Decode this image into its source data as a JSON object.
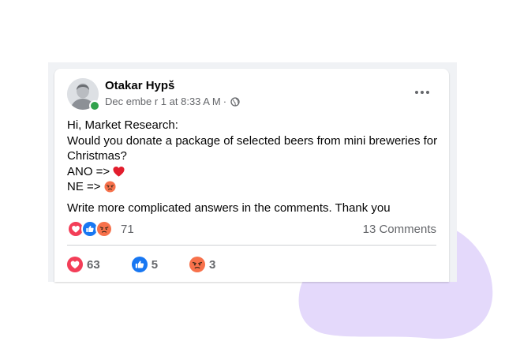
{
  "post": {
    "author": "Otakar Hypš",
    "timestamp": "Dec embe r 1 at 8:33 A M",
    "separator": "·",
    "privacy_icon": "globe-icon",
    "more_icon": "more-horizontal-icon",
    "lines": [
      "Hi, Market Research:",
      "Would you donate a package of selected beers from mini breweries for Christmas?",
      "ANO =>",
      "NE =>",
      "Write more complicated answers in the comments. Thank you"
    ],
    "option_icons": [
      "red-heart-emoji",
      "angry-face-emoji"
    ]
  },
  "reactions": {
    "icons": [
      "love-reaction-icon",
      "like-reaction-icon",
      "angry-reaction-icon"
    ],
    "total": "71",
    "comments": "13 Comments"
  },
  "stats": [
    {
      "icon": "love-reaction-icon",
      "count": "63"
    },
    {
      "icon": "like-reaction-icon",
      "count": "5"
    },
    {
      "icon": "angry-reaction-icon",
      "count": "3"
    }
  ],
  "colors": {
    "like_blue": "#1877f2",
    "love_red": "#f33e58",
    "angry_orange": "#f7714b",
    "online_green": "#31a24c",
    "blob_lavender": "#e4d9fb",
    "frame_gray": "#f0f2f5"
  }
}
